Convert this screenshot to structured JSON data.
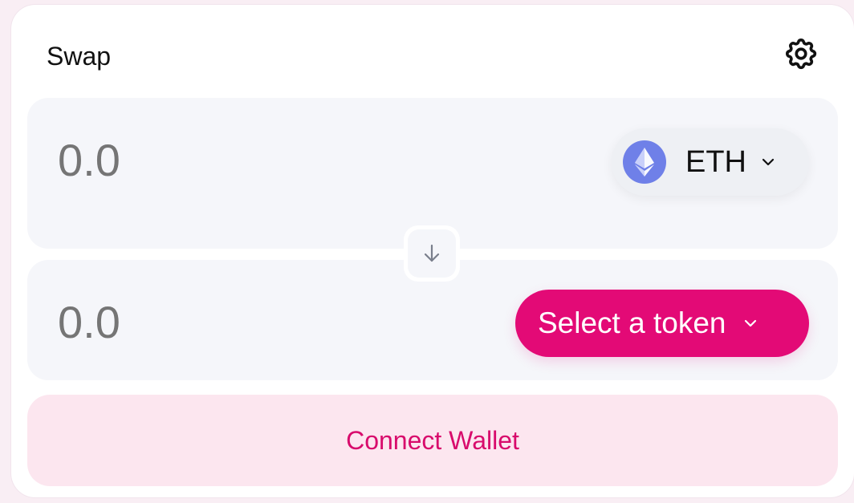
{
  "swap": {
    "title": "Swap",
    "settings_icon": "gear-icon",
    "from": {
      "amount_placeholder": "0.0",
      "token": {
        "symbol": "ETH",
        "icon": "ethereum-icon"
      }
    },
    "to": {
      "amount_placeholder": "0.0",
      "select_label": "Select a token"
    },
    "switch_icon": "arrow-down-icon",
    "connect_label": "Connect Wallet"
  },
  "colors": {
    "accent": "#e30a76",
    "connect_bg": "#fce6ef",
    "connect_text": "#d80b6c",
    "panel_bg": "#f5f6fa",
    "eth_blue": "#6f80e8"
  }
}
